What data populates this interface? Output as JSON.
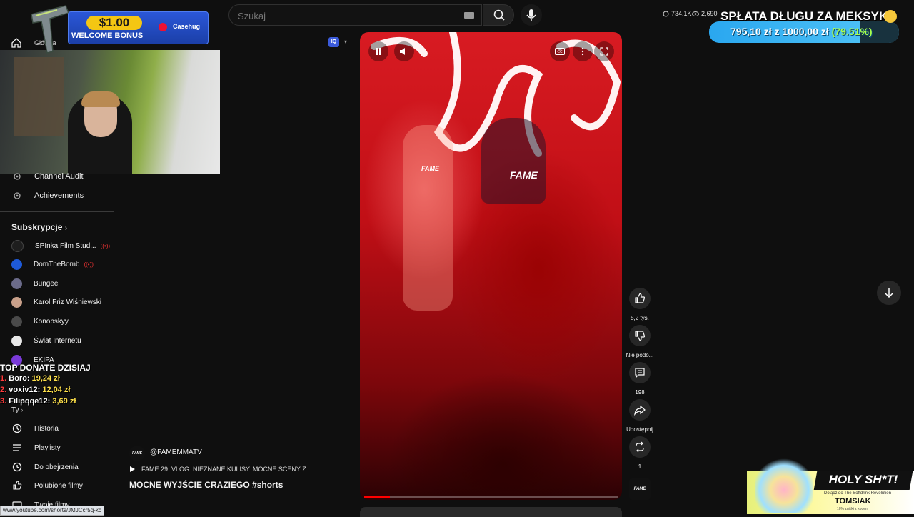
{
  "topbar": {
    "search_placeholder": "Szukaj",
    "viewers": "734.1K",
    "views": "2,690",
    "home_label": "Główna"
  },
  "bonus": {
    "amount": "$1.00",
    "text": "WELCOME BONUS",
    "brand": "Casehug"
  },
  "goal": {
    "title": "SPŁATA DŁUGU ZA MEKSYK",
    "current": "795,10 zł",
    "between": " z ",
    "target": "1000,00 zł",
    "percent": "(79.51%)",
    "progress": 0.7951
  },
  "sidebar": {
    "upper_items": [
      {
        "label": "Channel Audit",
        "icon": "gear-icon"
      },
      {
        "label": "Achievements",
        "icon": "gear-icon"
      }
    ],
    "subscriptions_header": "Subskrypcje",
    "subscriptions": [
      {
        "label": "SPInka Film Stud...",
        "live": "((•))",
        "color": "#1e1e1e"
      },
      {
        "label": "DomTheBomb",
        "live": "((•))",
        "color": "#1e5ad8"
      },
      {
        "label": "Bungee",
        "live": "",
        "color": "#6b6b8a"
      },
      {
        "label": "Karol Friz Wiśniewski",
        "live": "",
        "color": "#c9a08a"
      },
      {
        "label": "Konopskyy",
        "live": "",
        "color": "#4a4a4a"
      },
      {
        "label": "Świat Internetu",
        "live": "",
        "color": "#e8e8e8"
      },
      {
        "label": "EKIPA",
        "live": "",
        "color": "#7a3ad8"
      }
    ],
    "you_header": "Ty",
    "you_items": [
      {
        "label": "Historia",
        "icon": "history-icon"
      },
      {
        "label": "Playlisty",
        "icon": "playlist-icon"
      },
      {
        "label": "Do obejrzenia",
        "icon": "clock-icon"
      },
      {
        "label": "Polubione filmy",
        "icon": "like-icon"
      },
      {
        "label": "Twoje filmy",
        "icon": "video-icon"
      }
    ]
  },
  "donate": {
    "title": "TOP DONATE DZISIAJ",
    "entries": [
      {
        "rank": "1.",
        "name": "Boro:",
        "amount": "19,24 zł"
      },
      {
        "rank": "2.",
        "name": "voxiv12:",
        "amount": "12,04 zł"
      },
      {
        "rank": "3.",
        "name": "Filipqqe12:",
        "amount": "3,69 zł"
      }
    ]
  },
  "short": {
    "channel_handle": "@FAMEMMATV",
    "channel_logo": "FAME",
    "playlist": "FAME 29. VLOG. NIEZNANE KULISY. MOCNE SCENY Z ...",
    "title": "MOCNE WYJŚCIE CRAZIEGO #shorts",
    "jersey_text": "FAME",
    "progress": 0.1,
    "iq_label": "IQ"
  },
  "actions": {
    "likes": "5,2 tys.",
    "dislike_label": "Nie podo...",
    "comments": "198",
    "share_label": "Udostępnij",
    "remix_count": "1"
  },
  "holy": {
    "headline": "HOLY SH*T!",
    "sub1": "Dołącz do The Softdrink Revolution",
    "name": "TOMSIAK",
    "sub2": "10% zniżki z kodem"
  },
  "statusbar": {
    "url": "www.youtube.com/shorts/JMJCcr5q-kc"
  },
  "colors": {
    "background": "#0f0f0f",
    "accent_red": "#ff0000",
    "goal_blue": "#2aa7ef"
  }
}
